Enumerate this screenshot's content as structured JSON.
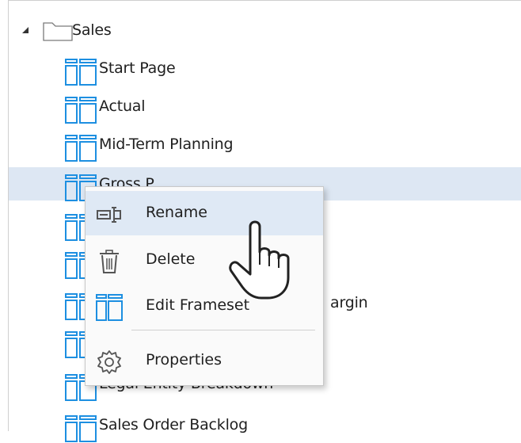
{
  "tree": {
    "folder": {
      "label": "Sales",
      "icon": "folder-icon",
      "expander_icon": "collapse-triangle-icon"
    },
    "items": [
      {
        "label": "Start Page",
        "icon": "frameset-icon"
      },
      {
        "label": "Actual",
        "icon": "frameset-icon"
      },
      {
        "label": "Mid-Term Planning",
        "icon": "frameset-icon"
      },
      {
        "label": "Gross P...",
        "icon": "frameset-icon",
        "selected": true
      },
      {
        "label": "",
        "icon": "frameset-icon"
      },
      {
        "label": "",
        "icon": "frameset-icon"
      },
      {
        "label": "...Margin",
        "icon": "frameset-icon"
      },
      {
        "label": "",
        "icon": "frameset-icon"
      },
      {
        "label": "Legal Entity Breakdown",
        "icon": "frameset-icon"
      },
      {
        "label": "Sales Order Backlog",
        "icon": "frameset-icon"
      }
    ]
  },
  "context_menu": {
    "items": [
      {
        "label": "Rename",
        "icon": "rename-icon",
        "highlighted": true
      },
      {
        "label": "Delete",
        "icon": "trash-icon"
      },
      {
        "label": "Edit Frameset",
        "icon": "frameset-icon"
      },
      {
        "label": "Properties",
        "icon": "gear-icon"
      }
    ]
  },
  "colors": {
    "icon_blue": "#1d8fe1",
    "selection": "#dde7f3",
    "menu_highlight": "#dfe9f5"
  },
  "visible_fragments": {
    "margin_text": "argin"
  }
}
